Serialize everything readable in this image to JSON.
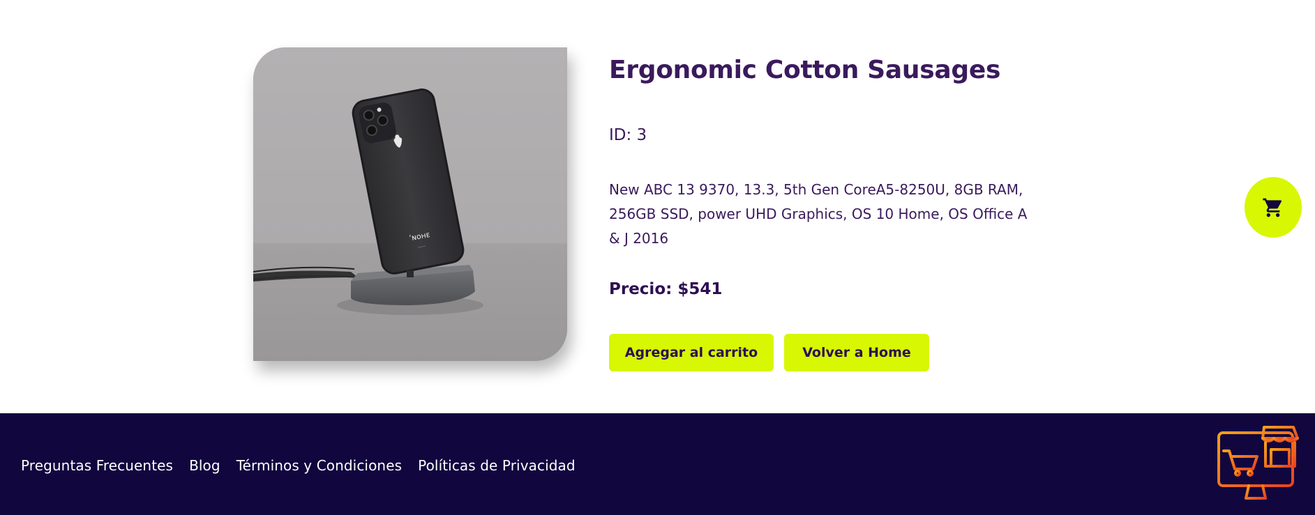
{
  "product": {
    "name": "Ergonomic Cotton Sausages",
    "id_text": "ID: 3",
    "description": "New ABC 13 9370, 13.3, 5th Gen CoreA5-8250U, 8GB RAM, 256GB SSD, power UHD Graphics, OS 10 Home, OS Office A & J 2016",
    "price_text": "Precio: $541",
    "image_icon": "phone-on-stand-photo"
  },
  "actions": {
    "add_to_cart_label": "Agregar al carrito",
    "back_home_label": "Volver a Home"
  },
  "floating_cart": {
    "icon": "cart-icon"
  },
  "footer": {
    "links": [
      "Preguntas Frecuentes",
      "Blog",
      "Términos y Condiciones",
      "Políticas de Privacidad"
    ],
    "logo_icon": "store-computer-logo"
  },
  "colors": {
    "accent": "#d7f703",
    "text_primary": "#3a1a5c",
    "footer_bg": "#12063f",
    "logo_gradient_start": "#f7a11a",
    "logo_gradient_end": "#e8431f"
  }
}
